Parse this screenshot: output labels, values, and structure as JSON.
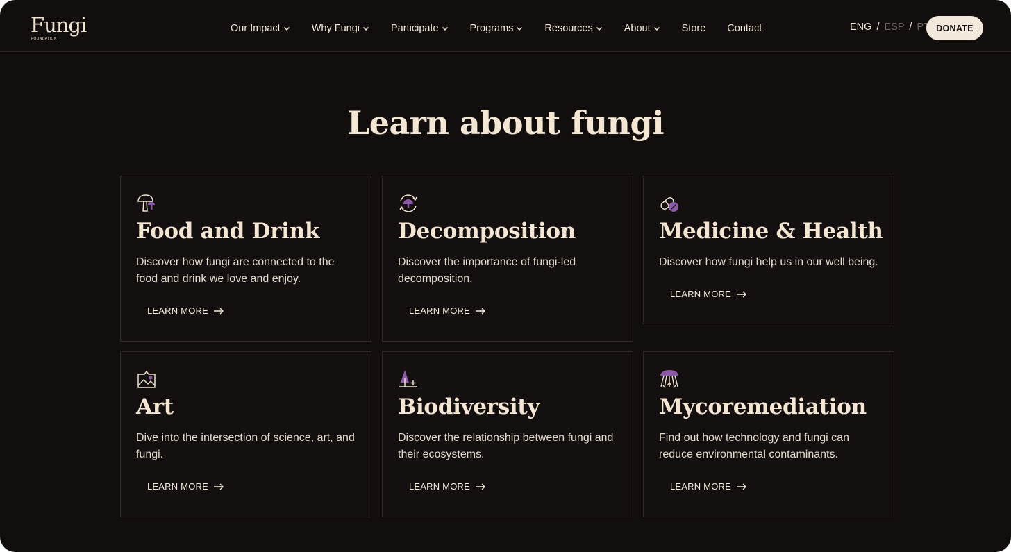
{
  "brand": {
    "logo_word": "Fungi",
    "logo_sub": "FOUNDATION"
  },
  "nav": {
    "items": [
      {
        "label": "Our Impact",
        "dropdown": true
      },
      {
        "label": "Why Fungi",
        "dropdown": true
      },
      {
        "label": "Participate",
        "dropdown": true
      },
      {
        "label": "Programs",
        "dropdown": true
      },
      {
        "label": "Resources",
        "dropdown": true
      },
      {
        "label": "About",
        "dropdown": true
      },
      {
        "label": "Store",
        "dropdown": false
      },
      {
        "label": "Contact",
        "dropdown": false
      }
    ]
  },
  "lang": {
    "eng": "ENG",
    "esp": "ESP",
    "pt": "PT",
    "separator": "/"
  },
  "donate_label": "DONATE",
  "heading": "Learn about fungi",
  "cards": [
    {
      "title": "Food and Drink",
      "desc": "Discover how fungi are connected to the food and drink we love and enjoy.",
      "cta": "LEARN MORE",
      "icon": "mushroom-icon"
    },
    {
      "title": "Decomposition",
      "desc": "Discover the importance of fungi-led decomposition.",
      "cta": "LEARN MORE",
      "icon": "cycle-icon"
    },
    {
      "title": "Medicine & Health",
      "desc": "Discover how fungi help us in our well being.",
      "cta": "LEARN MORE",
      "icon": "pill-icon"
    },
    {
      "title": "Art",
      "desc": "Dive into the intersection of science, art, and fungi.",
      "cta": "LEARN MORE",
      "icon": "picture-icon"
    },
    {
      "title": "Biodiversity",
      "desc": "Discover the relationship between fungi and their ecosystems.",
      "cta": "LEARN MORE",
      "icon": "tree-icon"
    },
    {
      "title": "Mycoremediation",
      "desc": "Find out how technology and fungi can reduce environmental contaminants.",
      "cta": "LEARN MORE",
      "icon": "mycelium-icon"
    }
  ],
  "colors": {
    "background": "#120e0d",
    "text": "#f3e6d3",
    "accent": "#8c5aa8",
    "donate_bg": "#f2e9dc"
  }
}
